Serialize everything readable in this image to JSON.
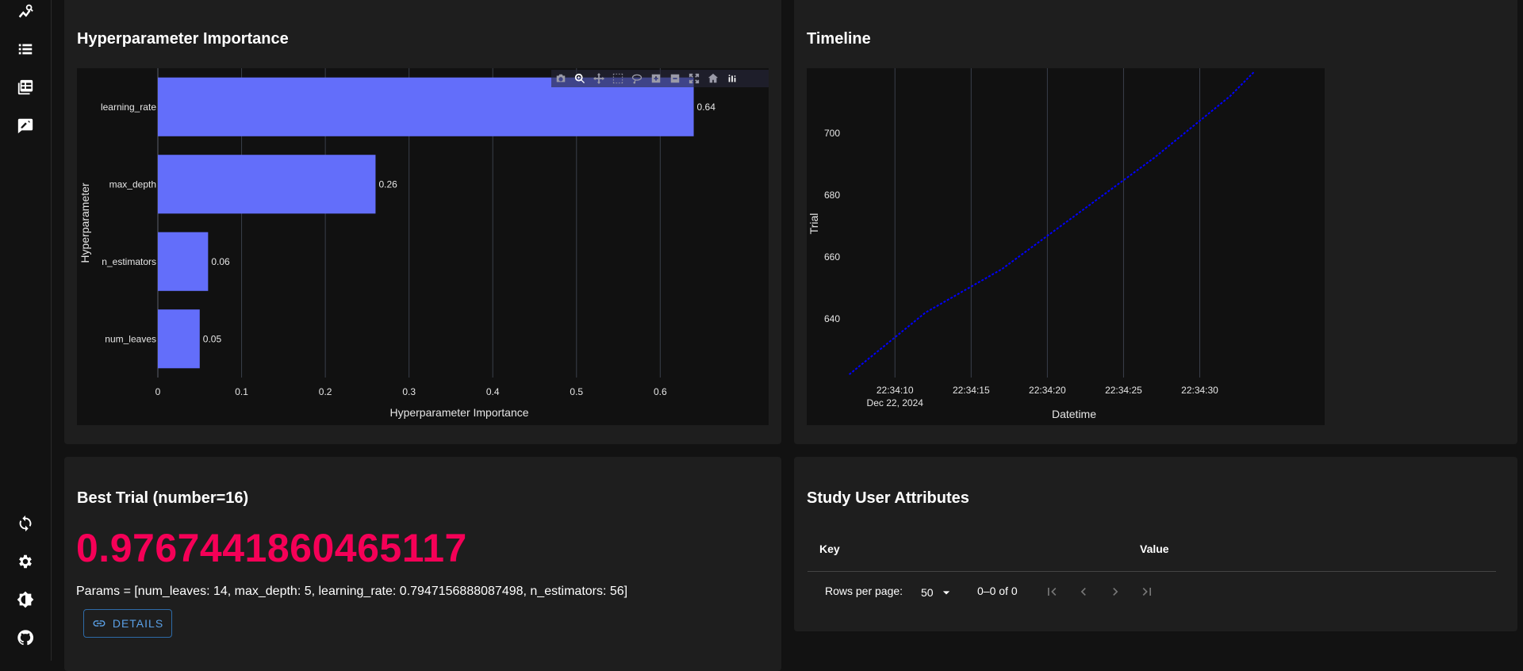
{
  "sidebar": {
    "icons": [
      "chart-search-icon",
      "list-icon",
      "table-icon",
      "note-icon",
      "reload-icon",
      "settings-icon",
      "theme-icon",
      "github-icon"
    ]
  },
  "importance_card": {
    "title": "Hyperparameter Importance"
  },
  "timeline_card": {
    "title": "Timeline"
  },
  "best_trial": {
    "title": "Best Trial (number=16)",
    "value": "0.9767441860465117",
    "params": "Params = [num_leaves: 14, max_depth: 5, learning_rate: 0.7947156888087498, n_estimators: 56]",
    "details_label": "DETAILS"
  },
  "user_attrs": {
    "title": "Study User Attributes",
    "col_key": "Key",
    "col_value": "Value",
    "rows_per_page_label": "Rows per page:",
    "rows_per_page": "50",
    "range": "0–0 of 0"
  },
  "chart_data": [
    {
      "type": "bar",
      "orientation": "horizontal",
      "title": "",
      "categories": [
        "learning_rate",
        "max_depth",
        "n_estimators",
        "num_leaves"
      ],
      "values": [
        0.64,
        0.26,
        0.06,
        0.05
      ],
      "value_labels": [
        "0.64",
        "0.26",
        "0.06",
        "0.05"
      ],
      "xlabel": "Hyperparameter Importance",
      "ylabel": "Hyperparameter",
      "xlim": [
        0,
        0.72
      ],
      "xticks": [
        0,
        0.1,
        0.2,
        0.3,
        0.4,
        0.5,
        0.6
      ],
      "xtick_labels": [
        "0",
        "0.1",
        "0.2",
        "0.3",
        "0.4",
        "0.5",
        "0.6"
      ],
      "grid": true,
      "color": "#636efa"
    },
    {
      "type": "line",
      "title": "",
      "xlabel": "Datetime",
      "ylabel": "Trial",
      "x_range_seconds": [
        "22:34:06.5",
        "22:34:37"
      ],
      "xticks": [
        "22:34:10",
        "22:34:15",
        "22:34:20",
        "22:34:25",
        "22:34:30"
      ],
      "xtick_sublabel": "Dec 22, 2024",
      "ylim": [
        621,
        721
      ],
      "yticks": [
        640,
        660,
        680,
        700
      ],
      "series": [
        {
          "x": [
            "22:34:07",
            "22:34:12",
            "22:34:17",
            "22:34:22",
            "22:34:27",
            "22:34:32",
            "22:34:33.6"
          ],
          "y": [
            622,
            642,
            656,
            674,
            692,
            712,
            720
          ],
          "color": "#0000ff"
        }
      ],
      "grid": true
    }
  ]
}
